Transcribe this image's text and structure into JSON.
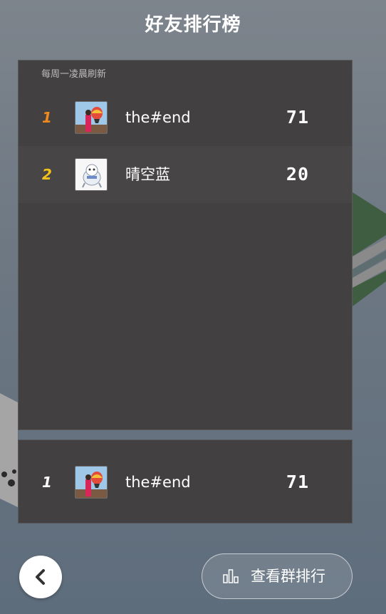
{
  "header": {
    "title": "好友排行榜"
  },
  "leaderboard": {
    "subtitle": "每周一凌晨刷新",
    "rows": [
      {
        "rank": "1",
        "name": "the#end",
        "score": "71",
        "rank_color": "#f08a1c",
        "avatar": "hot-air-balloon-photo"
      },
      {
        "rank": "2",
        "name": "晴空蓝",
        "score": "20",
        "rank_color": "#f2c21b",
        "avatar": "cartoon-character-image"
      }
    ]
  },
  "self_entry": {
    "rank": "1",
    "name": "the#end",
    "score": "71",
    "avatar": "hot-air-balloon-photo"
  },
  "footer": {
    "group_rank_label": "查看群排行"
  }
}
